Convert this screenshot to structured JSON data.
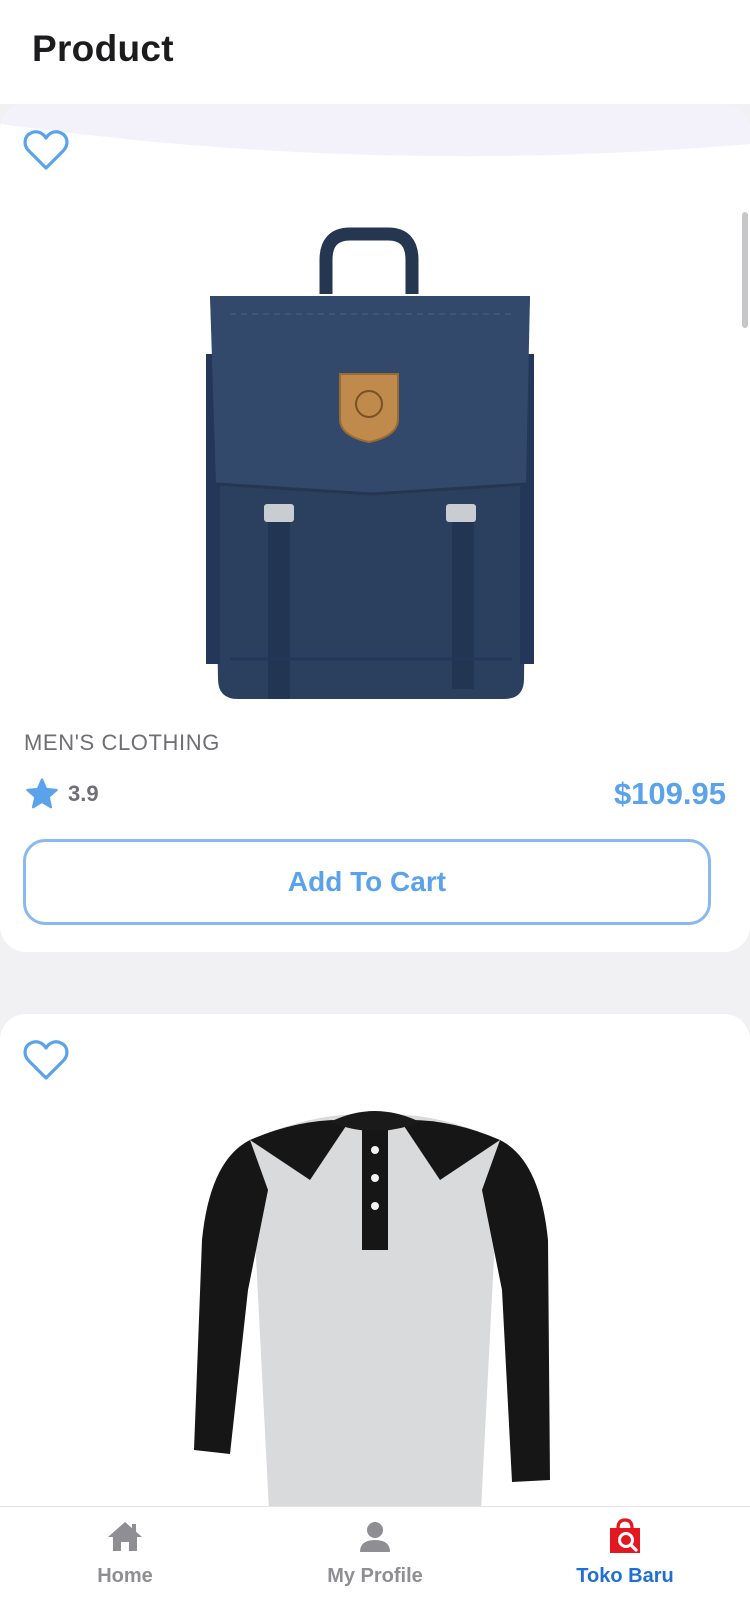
{
  "header": {
    "title": "Product"
  },
  "products": [
    {
      "category": "MEN'S CLOTHING",
      "rating": "3.9",
      "price": "$109.95",
      "add_to_cart_label": "Add To Cart",
      "image": "navy-backpack"
    },
    {
      "image": "raglan-henley-shirt"
    }
  ],
  "tabbar": {
    "items": [
      {
        "label": "Home",
        "icon": "home-icon",
        "active": false
      },
      {
        "label": "My Profile",
        "icon": "person-icon",
        "active": false
      },
      {
        "label": "Toko Baru",
        "icon": "shopping-bag-search-icon",
        "active": true
      }
    ]
  },
  "colors": {
    "accent": "#5aa2ec",
    "button_border": "#8ab9ef",
    "active_tab": "#1f6fd6",
    "active_tab_icon": "#e4161f",
    "inactive_tab": "#8e8e93",
    "background": "#f1f1f3"
  }
}
